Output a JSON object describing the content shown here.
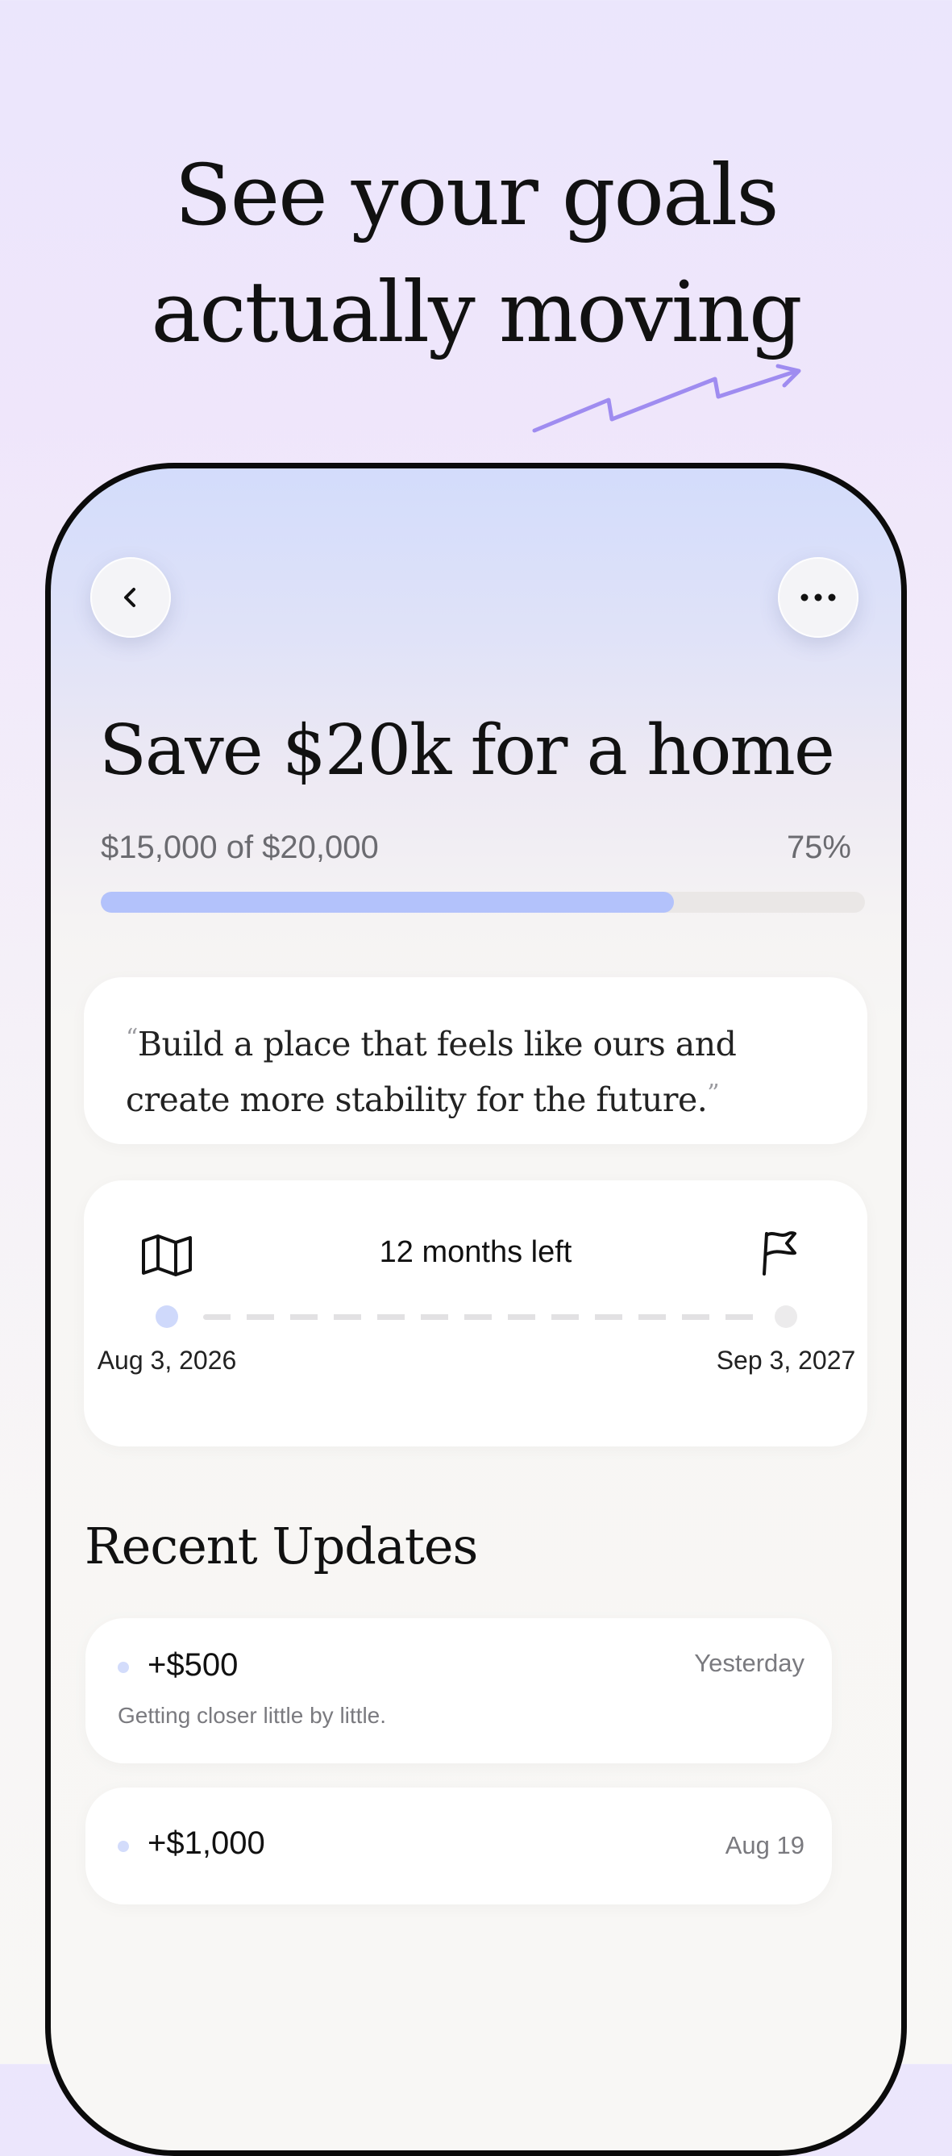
{
  "headline": {
    "line1": "See your goals",
    "line2": "actually moving"
  },
  "colors": {
    "accent": "#b3c2fb",
    "arrow": "#9f8cf0",
    "track": "#eae7e6"
  },
  "goal": {
    "title": "Save $20k for a home",
    "progress_text": "$15,000 of $20,000",
    "progress_percent_label": "75%",
    "progress_fraction": 0.75,
    "quote": "Build a place that feels like ours and create more stability for the future.",
    "quote_open": "“",
    "quote_close": "”"
  },
  "timeline": {
    "remaining": "12 months left",
    "start_date": "Aug 3, 2026",
    "end_date": "Sep 3, 2027",
    "start_icon": "map-icon",
    "end_icon": "flag-icon"
  },
  "updates": {
    "title": "Recent Updates",
    "items": [
      {
        "amount": "+$500",
        "date": "Yesterday",
        "note": "Getting closer little by little."
      },
      {
        "amount": "+$1,000",
        "date": "Aug 19",
        "note": ""
      }
    ]
  },
  "icons": {
    "back": "chevron-left-icon",
    "more": "more-horizontal-icon"
  }
}
